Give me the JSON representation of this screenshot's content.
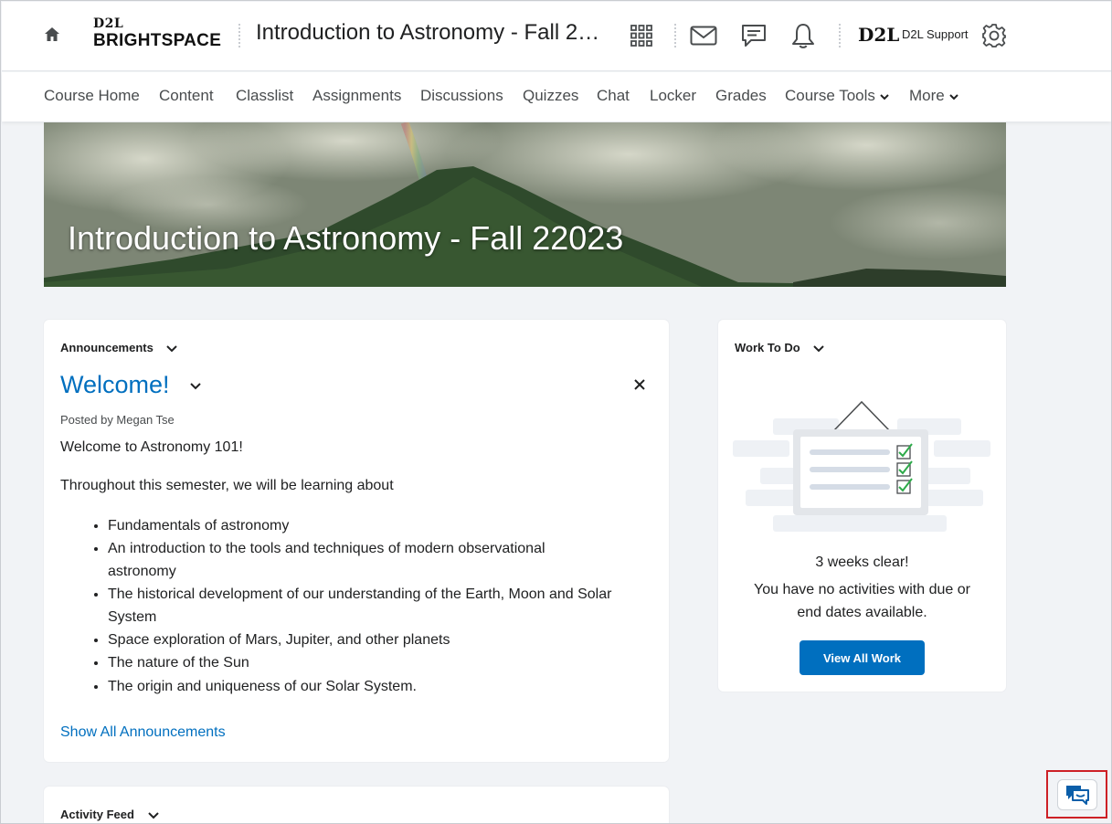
{
  "header": {
    "logo_top": "D2L",
    "logo_bottom": "BRIGHTSPACE",
    "course_title": "Introduction to Astronomy - Fall 22...",
    "org_logo": "D2L",
    "user_name": "D2L Support",
    "icons": [
      "home-icon",
      "waffle-grid-icon",
      "mail-icon",
      "message-bubble-icon",
      "bell-icon",
      "gear-icon"
    ]
  },
  "nav": {
    "items": [
      "Course Home",
      "Content",
      "Classlist",
      "Assignments",
      "Discussions",
      "Quizzes",
      "Chat",
      "Locker",
      "Grades",
      "Course Tools",
      "More"
    ]
  },
  "banner": {
    "title": "Introduction to Astronomy - Fall 22023"
  },
  "announcements": {
    "heading": "Announcements",
    "title": "Welcome!",
    "posted_by": "Posted by Megan Tse",
    "intro": "Welcome to Astronomy 101!",
    "lead": "Throughout this semester, we will be learning about",
    "topics": [
      "Fundamentals of astronomy",
      "An introduction to the tools and techniques of modern observational astronomy",
      "The historical development of our understanding of the Earth, Moon and Solar System",
      "Space exploration of Mars, Jupiter, and other planets",
      "The nature of the Sun",
      "The origin and uniqueness of our Solar System."
    ],
    "show_all": "Show All Announcements"
  },
  "work_to_do": {
    "heading": "Work To Do",
    "clear_text": "3 weeks clear!",
    "message_line1": "You have no activities with due or",
    "message_line2": "end dates available.",
    "button": "View All Work"
  },
  "activity_feed": {
    "heading": "Activity Feed"
  },
  "colors": {
    "link": "#006fbf",
    "primary_button": "#006fbf",
    "highlight_border": "#cd2026"
  }
}
